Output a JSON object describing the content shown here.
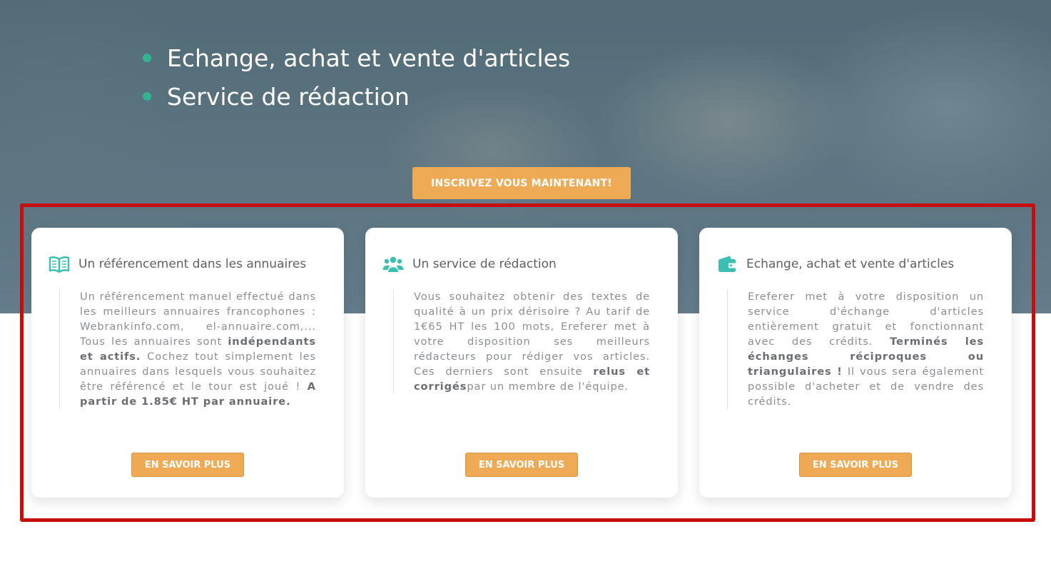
{
  "hero": {
    "bullets": [
      "Echange, achat et vente d'articles",
      "Service de rédaction"
    ],
    "cta_label": "INSCRIVEZ VOUS MAINTENANT!"
  },
  "cards": [
    {
      "icon": "open-book-icon",
      "title": "Un référencement dans les annuaires",
      "body": [
        {
          "t": "Un référencement manuel effectué dans les meilleurs annuaires francophones : Webrankinfo.com, el-annuaire.com,... Tous les annuaires sont "
        },
        {
          "b": "indépendants et actifs."
        },
        {
          "t": " Cochez tout simplement les annuaires dans lesquels vous souhaitez être référencé et le tour est joué ! "
        },
        {
          "b": "A partir de 1.85€ HT par annuaire."
        }
      ],
      "button": "EN SAVOIR PLUS"
    },
    {
      "icon": "users-group-icon",
      "title": "Un service de rédaction",
      "body": [
        {
          "t": "Vous souhaitez obtenir des textes de qualité à un prix dérisoire ? Au tarif de 1€65 HT les 100 mots, Ereferer met à votre disposition ses meilleurs rédacteurs pour rédiger vos articles. Ces derniers sont ensuite "
        },
        {
          "b": "relus et corrigés"
        },
        {
          "t": "par un membre de l'équipe."
        }
      ],
      "button": "EN SAVOIR PLUS"
    },
    {
      "icon": "wallet-icon",
      "title": "Echange, achat et vente d'articles",
      "body": [
        {
          "t": "Ereferer met à votre disposition un service d'échange d'articles entièrement gratuit et fonctionnant avec des crédits. "
        },
        {
          "b": "Terminés les échanges réciproques ou triangulaires !"
        },
        {
          "t": " Il vous sera également possible d'acheter et de vendre des crédits."
        }
      ],
      "button": "EN SAVOIR PLUS"
    }
  ],
  "colors": {
    "accent": "#eeaa55",
    "teal": "#2fb58f",
    "icon_teal": "#3bbfb0",
    "highlight_red": "#c80d0d"
  }
}
